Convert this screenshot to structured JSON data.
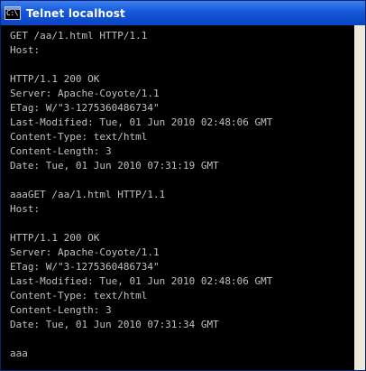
{
  "window": {
    "title": "Telnet localhost",
    "icon_label": "C:\\"
  },
  "console": {
    "lines": [
      "GET /aa/1.html HTTP/1.1",
      "Host:",
      "",
      "HTTP/1.1 200 OK",
      "Server: Apache-Coyote/1.1",
      "ETag: W/\"3-1275360486734\"",
      "Last-Modified: Tue, 01 Jun 2010 02:48:06 GMT",
      "Content-Type: text/html",
      "Content-Length: 3",
      "Date: Tue, 01 Jun 2010 07:31:19 GMT",
      "",
      "aaaGET /aa/1.html HTTP/1.1",
      "Host:",
      "",
      "HTTP/1.1 200 OK",
      "Server: Apache-Coyote/1.1",
      "ETag: W/\"3-1275360486734\"",
      "Last-Modified: Tue, 01 Jun 2010 02:48:06 GMT",
      "Content-Type: text/html",
      "Content-Length: 3",
      "Date: Tue, 01 Jun 2010 07:31:34 GMT",
      "",
      "aaa"
    ]
  },
  "colors": {
    "title_bar": "#0a44c2",
    "console_background": "#000000",
    "console_text": "#c0c0c0"
  },
  "icons": {
    "window_icon": "console-window-icon"
  }
}
